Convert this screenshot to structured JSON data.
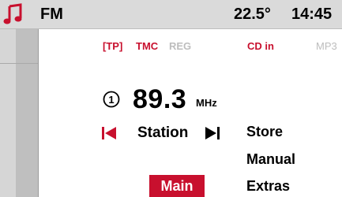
{
  "status_bar": {
    "source_icon": "music-note-icon",
    "band": "FM",
    "temperature": "22.5°",
    "time": "14:45"
  },
  "info_row": {
    "tp": "[TP]",
    "tmc": "TMC",
    "reg": "REG",
    "cd_in": "CD in",
    "mp3": "MP3"
  },
  "tuner": {
    "preset_number": "1",
    "frequency": "89.3",
    "unit": "MHz"
  },
  "station_row": {
    "seek_back_icon": "seek-back-icon",
    "label": "Station",
    "seek_forward_icon": "seek-forward-icon"
  },
  "menu": {
    "store": "Store",
    "manual": "Manual",
    "extras": "Extras",
    "main": "Main"
  },
  "colors": {
    "accent": "#c8102e",
    "inactive": "#bdbdbd",
    "bar": "#dadada"
  }
}
